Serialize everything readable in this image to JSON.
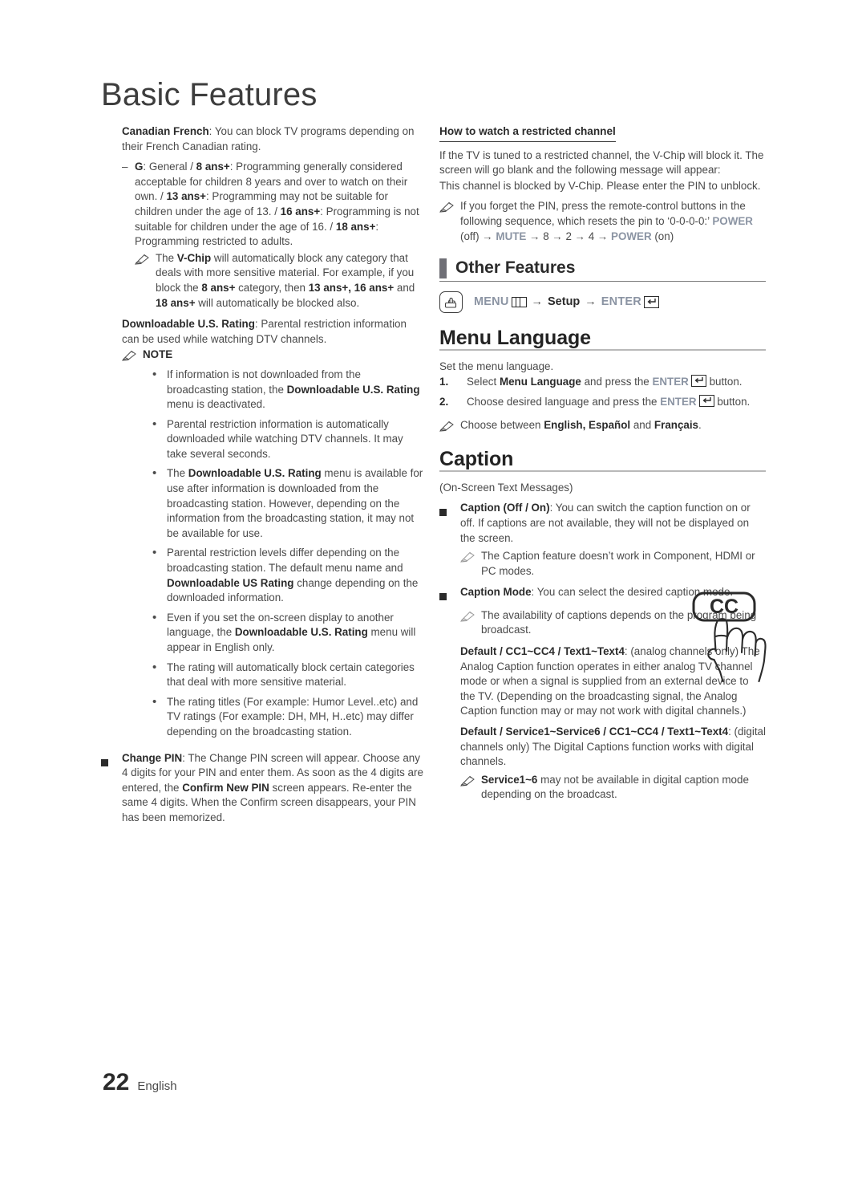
{
  "page": {
    "title": "Basic Features",
    "footer_number": "22",
    "footer_language": "English"
  },
  "colors": {
    "section_bar": "#6f6f76",
    "key_text": "#8b94a3",
    "body_text": "#4a4a4a",
    "bold_text": "#2b2b2b"
  },
  "left_column": {
    "canadian_french": {
      "label": "Canadian French",
      "text": ": You can block TV programs depending on their French Canadian rating."
    },
    "ratings_item": {
      "dash": "–",
      "parts": [
        {
          "t": "G",
          "b": true
        },
        {
          "t": ": General / ",
          "b": false
        },
        {
          "t": "8 ans+",
          "b": true
        },
        {
          "t": ": Programming generally considered acceptable for children 8 years and over to watch on their own. / ",
          "b": false
        },
        {
          "t": "13 ans+",
          "b": true
        },
        {
          "t": ": Programming may not be suitable for children under the age of 13. / ",
          "b": false
        },
        {
          "t": "16 ans+",
          "b": true
        },
        {
          "t": ": Programming is not suitable for children under the age of 16. / ",
          "b": false
        },
        {
          "t": "18 ans+",
          "b": true
        },
        {
          "t": ": Programming restricted to adults.",
          "b": false
        }
      ]
    },
    "vchip_note": {
      "parts": [
        {
          "t": "The ",
          "b": false
        },
        {
          "t": "V-Chip",
          "b": true
        },
        {
          "t": " will automatically block any category that deals with more sensitive material. For example, if you block the ",
          "b": false
        },
        {
          "t": "8 ans+",
          "b": true
        },
        {
          "t": " category, then ",
          "b": false
        },
        {
          "t": "13 ans+, 16 ans+",
          "b": true
        },
        {
          "t": " and ",
          "b": false
        },
        {
          "t": "18 ans+",
          "b": true
        },
        {
          "t": " will automatically be blocked also.",
          "b": false
        }
      ]
    },
    "downloadable_rating": {
      "label": "Downloadable U.S. Rating",
      "text": ": Parental restriction information can be used while watching DTV channels."
    },
    "note_label": "NOTE",
    "notes": [
      {
        "parts": [
          {
            "t": "If information is not downloaded from the broadcasting station, the ",
            "b": false
          },
          {
            "t": "Downloadable U.S. Rating",
            "b": true
          },
          {
            "t": " menu is deactivated.",
            "b": false
          }
        ]
      },
      {
        "parts": [
          {
            "t": "Parental restriction information is automatically downloaded while watching DTV channels. It may take several seconds.",
            "b": false
          }
        ]
      },
      {
        "parts": [
          {
            "t": "The ",
            "b": false
          },
          {
            "t": "Downloadable U.S. Rating",
            "b": true
          },
          {
            "t": " menu is available for use after information is downloaded from the broadcasting station. However, depending on the information from the broadcasting station, it may not be available for use.",
            "b": false
          }
        ]
      },
      {
        "parts": [
          {
            "t": "Parental restriction levels differ depending on the broadcasting station. The default menu name and ",
            "b": false
          },
          {
            "t": "Downloadable US Rating",
            "b": true
          },
          {
            "t": " change depending on the downloaded information.",
            "b": false
          }
        ]
      },
      {
        "parts": [
          {
            "t": "Even if you set the on-screen display to another language, the ",
            "b": false
          },
          {
            "t": "Downloadable U.S. Rating",
            "b": true
          },
          {
            "t": " menu will appear in English only.",
            "b": false
          }
        ]
      },
      {
        "parts": [
          {
            "t": "The rating will automatically block certain categories that deal with more sensitive material.",
            "b": false
          }
        ]
      },
      {
        "parts": [
          {
            "t": "The rating titles (For example: Humor Level..etc) and TV ratings (For example: DH, MH, H..etc) may differ depending on the broadcasting station.",
            "b": false
          }
        ]
      }
    ],
    "change_pin": {
      "parts": [
        {
          "t": "Change PIN",
          "b": true
        },
        {
          "t": ": The Change PIN screen will appear. Choose any 4 digits for your PIN and enter them. As soon as the 4 digits are entered, the ",
          "b": false
        },
        {
          "t": "Confirm New PIN",
          "b": true
        },
        {
          "t": " screen appears. Re-enter the same 4 digits. When the Confirm screen disappears, your PIN has been memorized.",
          "b": false
        }
      ]
    }
  },
  "right_column": {
    "restricted_channel": {
      "heading": "How to watch a restricted channel",
      "paragraph1": "If the TV is tuned to a restricted channel, the V-Chip will block it. The screen will go blank and the following message will appear:",
      "paragraph2": "This channel is blocked by V-Chip. Please enter the PIN to unblock."
    },
    "pin_reset_note": {
      "parts": [
        {
          "t": "If you forget the PIN, press the remote-control buttons in the following sequence, which resets the pin to ‘0-0-0-0:’ ",
          "b": false,
          "k": false
        },
        {
          "t": "POWER",
          "b": true,
          "k": true
        },
        {
          "t": " (off) ",
          "b": false,
          "k": false
        },
        {
          "t": "→ ",
          "b": false,
          "k": false
        },
        {
          "t": "MUTE",
          "b": true,
          "k": true
        },
        {
          "t": " → 8 → 2 → 4 → ",
          "b": false,
          "k": false
        },
        {
          "t": "POWER",
          "b": true,
          "k": true
        },
        {
          "t": " (on)",
          "b": false,
          "k": false
        }
      ]
    },
    "other_features_heading": "Other Features",
    "menu_path": {
      "icon": "hand-press-icon",
      "menu_label": "MENU",
      "arrow": "→",
      "setup_label": "Setup",
      "enter_label": "ENTER"
    },
    "menu_language": {
      "heading": "Menu Language",
      "intro": "Set the menu language.",
      "steps": [
        {
          "number": "1.",
          "parts": [
            {
              "t": "Select ",
              "b": false,
              "k": false
            },
            {
              "t": "Menu Language",
              "b": true,
              "k": false
            },
            {
              "t": " and press the ",
              "b": false,
              "k": false
            },
            {
              "t": "ENTER",
              "b": true,
              "k": true
            },
            {
              "t": "ENTERGLYPH",
              "b": false,
              "k": false
            },
            {
              "t": " button.",
              "b": false,
              "k": false
            }
          ]
        },
        {
          "number": "2.",
          "parts": [
            {
              "t": "Choose desired language and press the ",
              "b": false,
              "k": false
            },
            {
              "t": "ENTER",
              "b": true,
              "k": true
            },
            {
              "t": "ENTERGLYPH",
              "b": false,
              "k": false
            },
            {
              "t": " button.",
              "b": false,
              "k": false
            }
          ]
        }
      ],
      "note": {
        "parts": [
          {
            "t": "Choose between ",
            "b": false
          },
          {
            "t": "English, Español",
            "b": true
          },
          {
            "t": " and ",
            "b": false
          },
          {
            "t": "Français",
            "b": true
          },
          {
            "t": ".",
            "b": false
          }
        ]
      }
    },
    "caption": {
      "heading": "Caption",
      "subtitle": "(On-Screen Text Messages)",
      "caption_onoff": {
        "parts": [
          {
            "t": "Caption (Off / On)",
            "b": true
          },
          {
            "t": ": You can switch the caption function on or off. If captions are not available, they will not be displayed on the screen.",
            "b": false
          }
        ]
      },
      "caption_onoff_note": "The Caption feature doesn’t work in Component, HDMI or PC modes.",
      "caption_mode": {
        "parts": [
          {
            "t": "Caption Mode",
            "b": true
          },
          {
            "t": ": You can select the desired caption mode.",
            "b": false
          }
        ]
      },
      "caption_mode_note": "The availability of captions depends on the program being broadcast.",
      "analog_block": {
        "parts": [
          {
            "t": "Default / CC1~CC4 / Text1~Text4",
            "b": true
          },
          {
            "t": ": (analog channels only) The Analog Caption function operates in either analog TV channel mode or when a signal is supplied from an external device to the TV. (Depending on the broadcasting signal, the Analog Caption function may or may not work with digital channels.)",
            "b": false
          }
        ]
      },
      "digital_block": {
        "parts": [
          {
            "t": "Default / Service1~Service6 / CC1~CC4 / Text1~Text4",
            "b": true
          },
          {
            "t": ": (digital channels only) The Digital Captions function works with digital channels.",
            "b": false
          }
        ]
      },
      "digital_note": {
        "parts": [
          {
            "t": "Service1~6",
            "b": true
          },
          {
            "t": " may not be available in digital caption mode depending on the broadcast.",
            "b": false
          }
        ]
      },
      "cc_button_label": "CC"
    }
  }
}
